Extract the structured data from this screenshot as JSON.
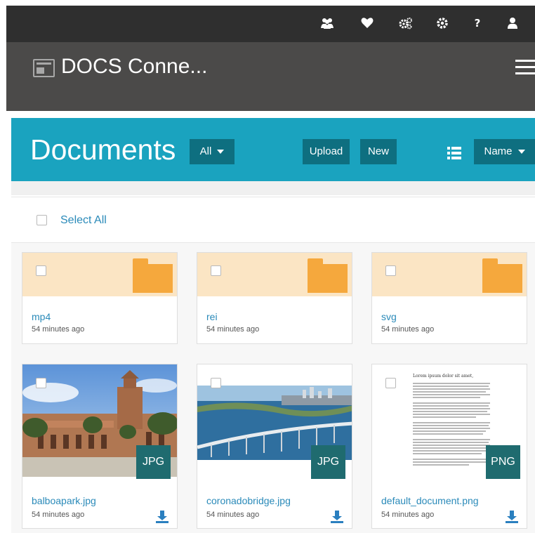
{
  "topbar": {
    "icons": [
      "users-icon",
      "heart-icon",
      "cogs-icon",
      "gear-icon",
      "help-icon",
      "user-icon"
    ],
    "help_glyph": "?"
  },
  "app": {
    "title": "DOCS Conne..."
  },
  "documents": {
    "title": "Documents",
    "filter_label": "All",
    "upload_label": "Upload",
    "new_label": "New",
    "sort_label": "Name",
    "select_all_label": "Select All"
  },
  "items": [
    {
      "name": "mp4",
      "time": "54 minutes ago",
      "kind": "folder"
    },
    {
      "name": "rei",
      "time": "54 minutes ago",
      "kind": "folder"
    },
    {
      "name": "svg",
      "time": "54 minutes ago",
      "kind": "folder"
    },
    {
      "name": "balboapark.jpg",
      "time": "54 minutes ago",
      "kind": "file",
      "type": "JPG"
    },
    {
      "name": "coronadobridge.jpg",
      "time": "54 minutes ago",
      "kind": "file",
      "type": "JPG"
    },
    {
      "name": "default_document.png",
      "time": "54 minutes ago",
      "kind": "file",
      "type": "PNG",
      "thumb_text": "Lorem ipsum dolor sit amet,"
    }
  ],
  "colors": {
    "topbar": "#2f2f2f",
    "appbar": "#4b4a49",
    "accent": "#1aa3bf",
    "button": "#0e6f80",
    "link": "#2a8ab9",
    "folder": "#f5a83d",
    "badge": "#1f6b6f"
  }
}
